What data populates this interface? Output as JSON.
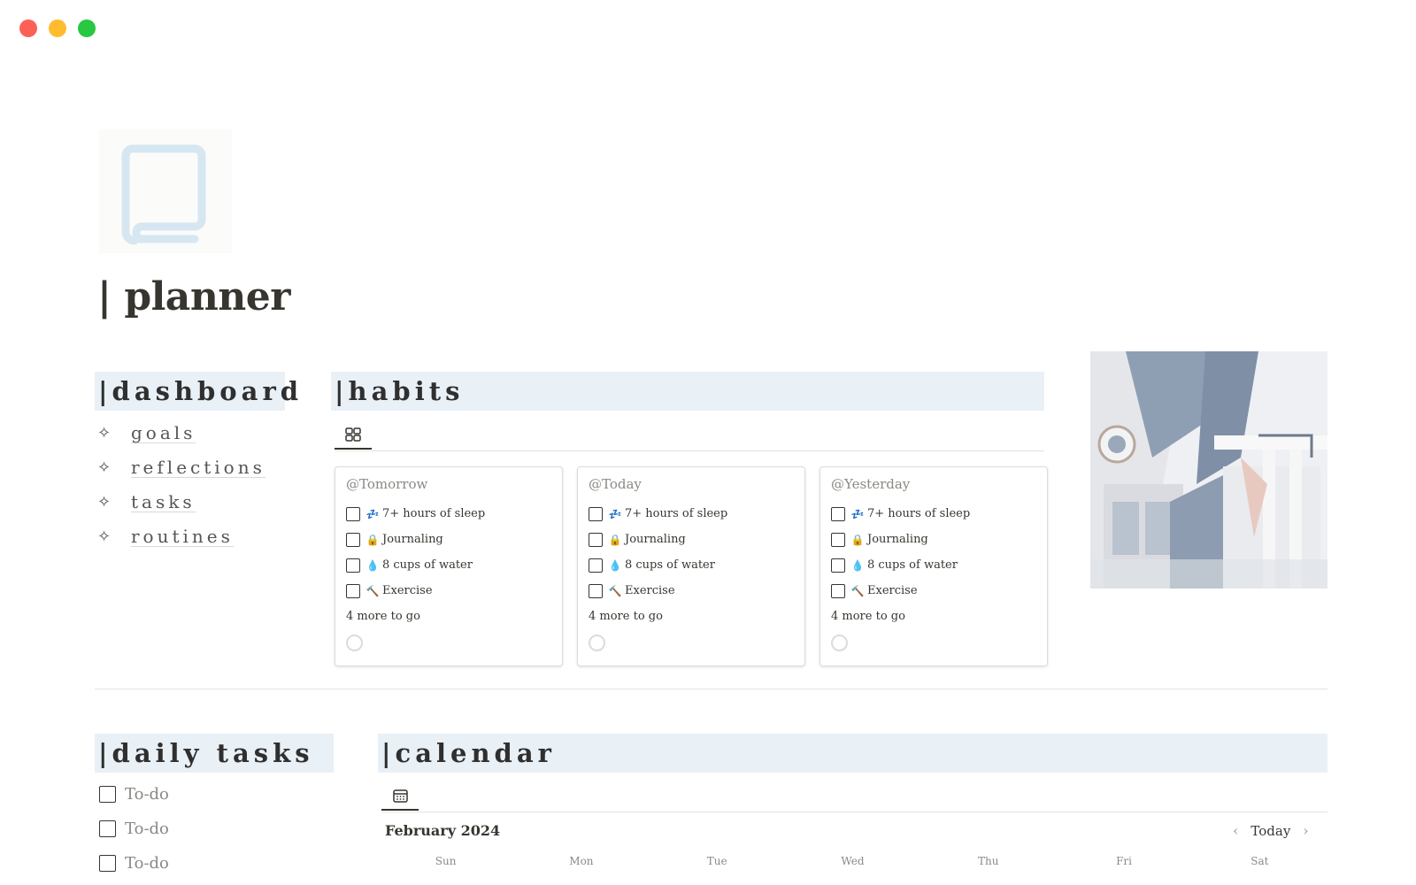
{
  "window": {
    "controls": [
      "close",
      "minimize",
      "zoom"
    ]
  },
  "page": {
    "icon": "book-icon",
    "title": "| planner"
  },
  "dashboard": {
    "heading": "|dashboard",
    "items": [
      {
        "icon": "sparkle-icon",
        "label": "goals"
      },
      {
        "icon": "sparkle-icon",
        "label": "reflections"
      },
      {
        "icon": "sparkle-icon",
        "label": "tasks"
      },
      {
        "icon": "sparkle-icon",
        "label": "routines"
      }
    ]
  },
  "habits": {
    "heading": "|habits",
    "view_icon": "gallery-view-icon",
    "cards": [
      {
        "title": "@Tomorrow",
        "items": [
          {
            "emoji": "💤",
            "label": "7+ hours of sleep"
          },
          {
            "emoji": "🔒",
            "label": "Journaling"
          },
          {
            "emoji": "💧",
            "label": "8 cups of water"
          },
          {
            "emoji": "🔨",
            "label": "Exercise"
          }
        ],
        "more": "4 more to go"
      },
      {
        "title": "@Today",
        "items": [
          {
            "emoji": "💤",
            "label": "7+ hours of sleep"
          },
          {
            "emoji": "🔒",
            "label": "Journaling"
          },
          {
            "emoji": "💧",
            "label": "8 cups of water"
          },
          {
            "emoji": "🔨",
            "label": "Exercise"
          }
        ],
        "more": "4 more to go"
      },
      {
        "title": "@Yesterday",
        "items": [
          {
            "emoji": "💤",
            "label": "7+ hours of sleep"
          },
          {
            "emoji": "🔒",
            "label": "Journaling"
          },
          {
            "emoji": "💧",
            "label": "8 cups of water"
          },
          {
            "emoji": "🔨",
            "label": "Exercise"
          }
        ],
        "more": "4 more to go"
      }
    ]
  },
  "daily_tasks": {
    "heading": "|daily tasks",
    "items": [
      "To-do",
      "To-do",
      "To-do"
    ]
  },
  "calendar": {
    "heading": "|calendar",
    "view_icon": "calendar-view-icon",
    "month": "February 2024",
    "today_label": "Today",
    "weekdays": [
      "Sun",
      "Mon",
      "Tue",
      "Wed",
      "Thu",
      "Fri",
      "Sat"
    ]
  },
  "colors": {
    "header_bg": "#e9f0f6",
    "text": "#37352f",
    "muted": "#8a8984",
    "icon_blue": "#dbe9f1"
  }
}
